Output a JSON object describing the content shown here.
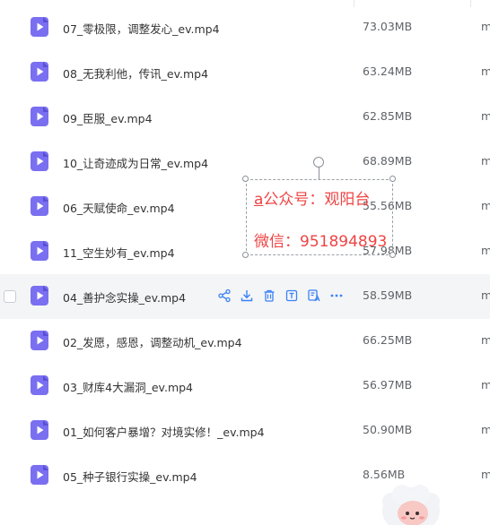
{
  "files": [
    {
      "name": "07_零极限，调整发心_ev.mp4",
      "size": "73.03MB",
      "modified": "m"
    },
    {
      "name": "08_无我利他，传讯_ev.mp4",
      "size": "63.24MB",
      "modified": "m"
    },
    {
      "name": "09_臣服_ev.mp4",
      "size": "62.85MB",
      "modified": "m"
    },
    {
      "name": "10_让奇迹成为日常_ev.mp4",
      "size": "68.89MB",
      "modified": "m"
    },
    {
      "name": "06_天赋使命_ev.mp4",
      "size": "55.56MB",
      "modified": "m"
    },
    {
      "name": "11_空生妙有_ev.mp4",
      "size": "57.98MB",
      "modified": "m"
    },
    {
      "name": "04_善护念实操_ev.mp4",
      "size": "58.59MB",
      "modified": "m"
    },
    {
      "name": "02_发愿，感恩，调整动机_ev.mp4",
      "size": "66.25MB",
      "modified": "m"
    },
    {
      "name": "03_财库4大漏洞_ev.mp4",
      "size": "56.97MB",
      "modified": "m"
    },
    {
      "name": "01_如何客户暴增？对境实修！_ev.mp4",
      "size": "50.90MB",
      "modified": "m"
    },
    {
      "name": "05_种子银行实操_ev.mp4",
      "size": "8.56MB",
      "modified": "m"
    }
  ],
  "row_actions": [
    "share-icon",
    "download-icon",
    "delete-icon",
    "extract-text-icon",
    "translate-icon",
    "more-icon"
  ],
  "watermark": {
    "line1_prefix": "a",
    "line1_rest": "公众号：观阳台",
    "line2": "微信：951894893"
  },
  "colors": {
    "file_icon": "#7a6ff0",
    "action_icon": "#3b82f6",
    "watermark": "#ef4444",
    "hover_row": "#f4f5f7"
  }
}
